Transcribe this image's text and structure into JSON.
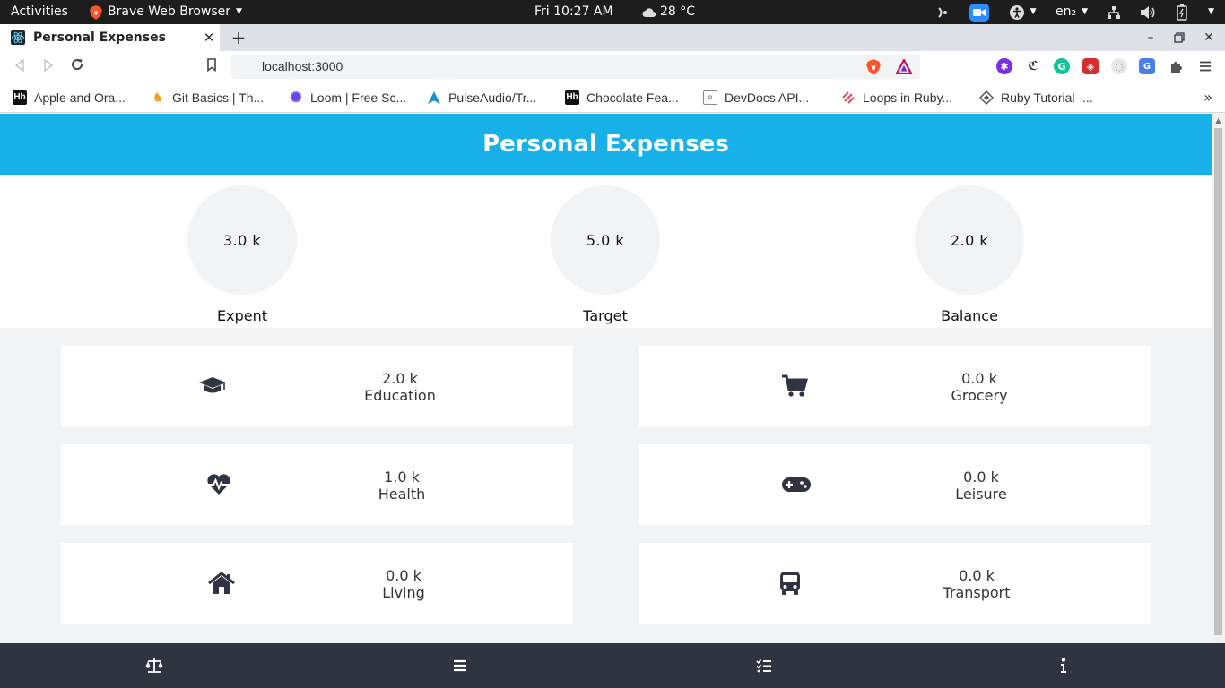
{
  "system_bar": {
    "activities": "Activities",
    "app_name": "Brave Web Browser",
    "clock": "Fri 10:27 AM",
    "weather": "28 °C",
    "language": "en₂"
  },
  "browser": {
    "tab_title": "Personal Expenses",
    "url": "localhost:3000",
    "bookmarks": [
      {
        "label": "Apple and Ora...",
        "icon": "hb-icon",
        "color": "#000000"
      },
      {
        "label": "Git Basics | Th...",
        "icon": "owl-icon",
        "color": "#f0a030"
      },
      {
        "label": "Loom | Free Sc...",
        "icon": "loom-icon",
        "color": "#6b44f6"
      },
      {
        "label": "PulseAudio/Tr...",
        "icon": "arch-icon",
        "color": "#1793d1"
      },
      {
        "label": "Chocolate Fea...",
        "icon": "hb-icon",
        "color": "#000000"
      },
      {
        "label": "DevDocs API...",
        "icon": "devdocs-icon",
        "color": "#888888"
      },
      {
        "label": "Loops in Ruby...",
        "icon": "stripes-icon",
        "color": "#e8475a"
      },
      {
        "label": "Ruby Tutorial -...",
        "icon": "diamond-icon",
        "color": "#555555"
      }
    ]
  },
  "app": {
    "title": "Personal Expenses",
    "accent_color": "#17b0e8",
    "summary": [
      {
        "value": "3.0  k",
        "label": "Expent"
      },
      {
        "value": "5.0  k",
        "label": "Target"
      },
      {
        "value": "2.0  k",
        "label": "Balance"
      }
    ],
    "categories": [
      {
        "value": "2.0  k",
        "label": "Education",
        "icon": "graduation-cap-icon"
      },
      {
        "value": "0.0  k",
        "label": "Grocery",
        "icon": "shopping-cart-icon"
      },
      {
        "value": "1.0  k",
        "label": "Health",
        "icon": "heartbeat-icon"
      },
      {
        "value": "0.0  k",
        "label": "Leisure",
        "icon": "gamepad-icon"
      },
      {
        "value": "0.0  k",
        "label": "Living",
        "icon": "home-icon"
      },
      {
        "value": "0.0  k",
        "label": "Transport",
        "icon": "bus-icon"
      }
    ],
    "bottom_nav": [
      {
        "icon": "balance-scale-icon"
      },
      {
        "icon": "bars-icon"
      },
      {
        "icon": "tasks-icon"
      },
      {
        "icon": "info-icon"
      }
    ]
  }
}
